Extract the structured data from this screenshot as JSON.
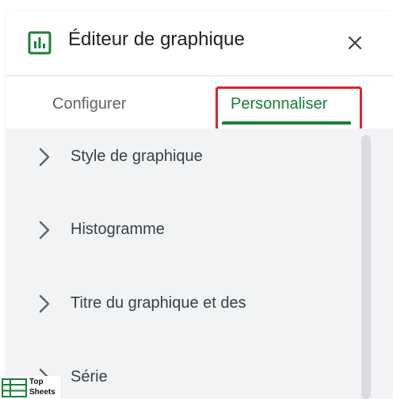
{
  "header": {
    "title": "Éditeur de graphique",
    "icon": "bar-chart-icon",
    "close_icon": "close-icon"
  },
  "tabs": [
    {
      "label": "Configurer",
      "active": false
    },
    {
      "label": "Personnaliser",
      "active": true
    }
  ],
  "sections": [
    {
      "label": "Style de graphique",
      "icon": "chevron-right-icon"
    },
    {
      "label": "Histogramme",
      "icon": "chevron-right-icon"
    },
    {
      "label": "Titre du graphique et des",
      "icon": "chevron-right-icon"
    },
    {
      "label": "Série",
      "icon": "chevron-right-icon"
    }
  ],
  "watermark": {
    "line1": "Top",
    "line2": "Sheets"
  },
  "colors": {
    "accent_green": "#188038",
    "highlight_red": "#e0242b",
    "content_bg": "#f1f3f4",
    "icon_green": "#188038"
  }
}
